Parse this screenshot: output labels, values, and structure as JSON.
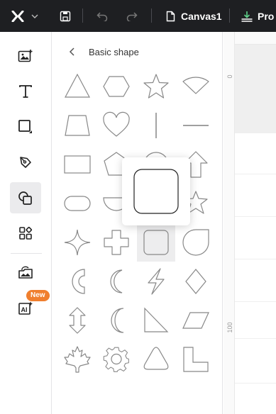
{
  "topbar": {
    "canvas_name": "Canvas1",
    "truncated_button": "Pro"
  },
  "rail": {
    "items": [
      {
        "name": "image",
        "icon": "image-plus-icon"
      },
      {
        "name": "text",
        "icon": "text-icon"
      },
      {
        "name": "shape",
        "icon": "square-shape-icon"
      },
      {
        "name": "pen",
        "icon": "pen-tool-icon"
      },
      {
        "name": "elements",
        "icon": "shapes-icon",
        "active": true
      },
      {
        "name": "apps",
        "icon": "apps-icon"
      },
      {
        "name": "uploads",
        "icon": "cloud-image-icon"
      },
      {
        "name": "ai",
        "icon": "ai-image-icon"
      }
    ],
    "new_badge": "New"
  },
  "panel": {
    "title": "Basic shape",
    "shapes": [
      "triangle",
      "hexagon",
      "star",
      "fan",
      "trapezoid",
      "heart",
      "vertical-line",
      "horizontal-line",
      "rectangle",
      "pentagon",
      "circle",
      "arrow-up",
      "rounded-rect",
      "half-circle",
      "rounded-square-large",
      "star-six",
      "four-point-star",
      "cross",
      "rounded-square",
      "teardrop",
      "thick-crescent",
      "crescent",
      "lightning",
      "diamond",
      "double-arrow",
      "moon",
      "right-triangle",
      "parallelogram",
      "maple-leaf",
      "gear",
      "rounded-triangle",
      "l-shape"
    ],
    "hovered_shape": "rounded-square"
  },
  "canvas": {
    "ruler_labels": [
      "0",
      "100"
    ]
  }
}
